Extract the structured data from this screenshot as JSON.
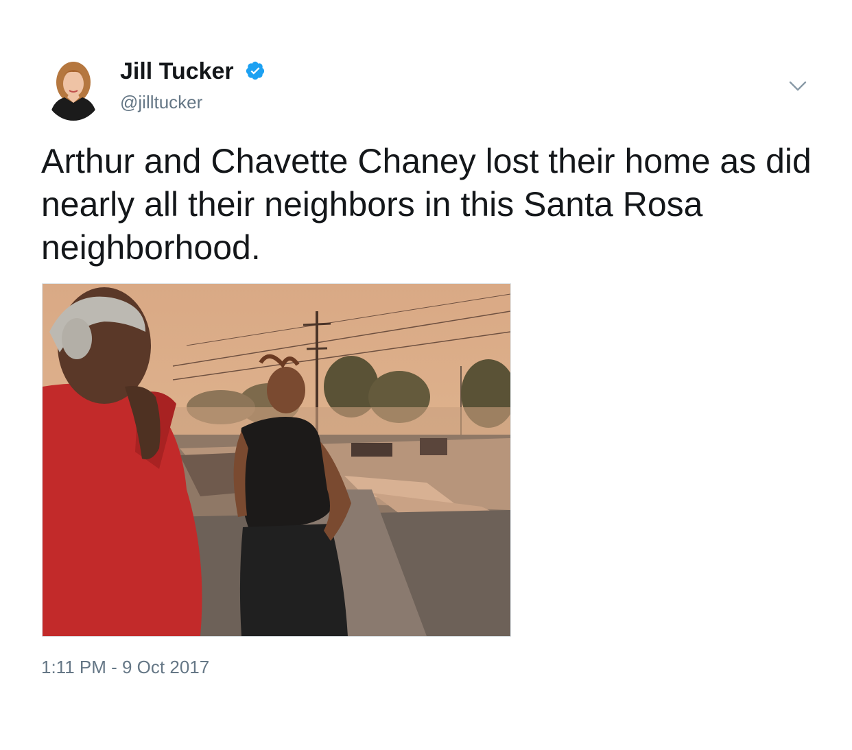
{
  "author": {
    "name": "Jill Tucker",
    "handle": "@jilltucker",
    "verified": true
  },
  "tweet": {
    "text": "Arthur and Chavette Chaney lost their home as did nearly all their neighbors in this Santa Rosa neighborhood.",
    "timestamp": "1:11 PM - 9 Oct 2017"
  },
  "icons": {
    "verified": "verified-badge-icon",
    "menu": "chevron-down-icon"
  },
  "colors": {
    "text_primary": "#14171a",
    "text_secondary": "#657786",
    "verified_blue": "#1da1f2"
  }
}
